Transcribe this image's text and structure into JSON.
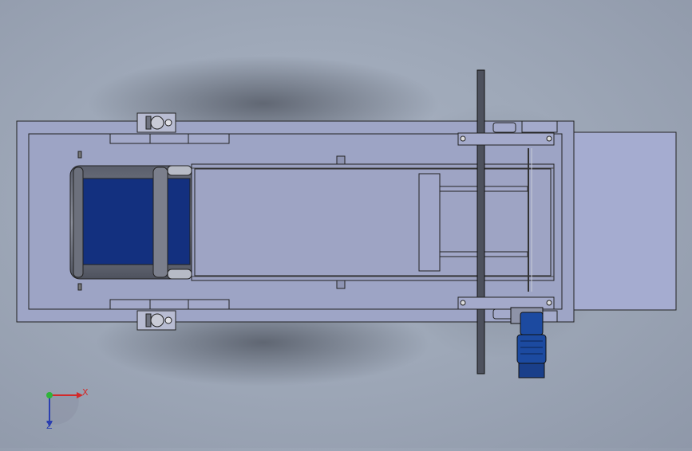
{
  "viewport": {
    "background_top": "#a9b2c2",
    "background_bottom": "#8f98a9",
    "model_fill": "#9ea5c6",
    "model_stroke": "#222222",
    "belt_color": "#13307f",
    "motor_color": "#1c4aa0"
  },
  "triad": {
    "x_label": "X",
    "z_label": "Z",
    "x_color": "#d22a2a",
    "y_color": "#2fb43a",
    "z_color": "#2b3fb0"
  },
  "icons": {
    "triad": "coordinate-triad-icon"
  }
}
